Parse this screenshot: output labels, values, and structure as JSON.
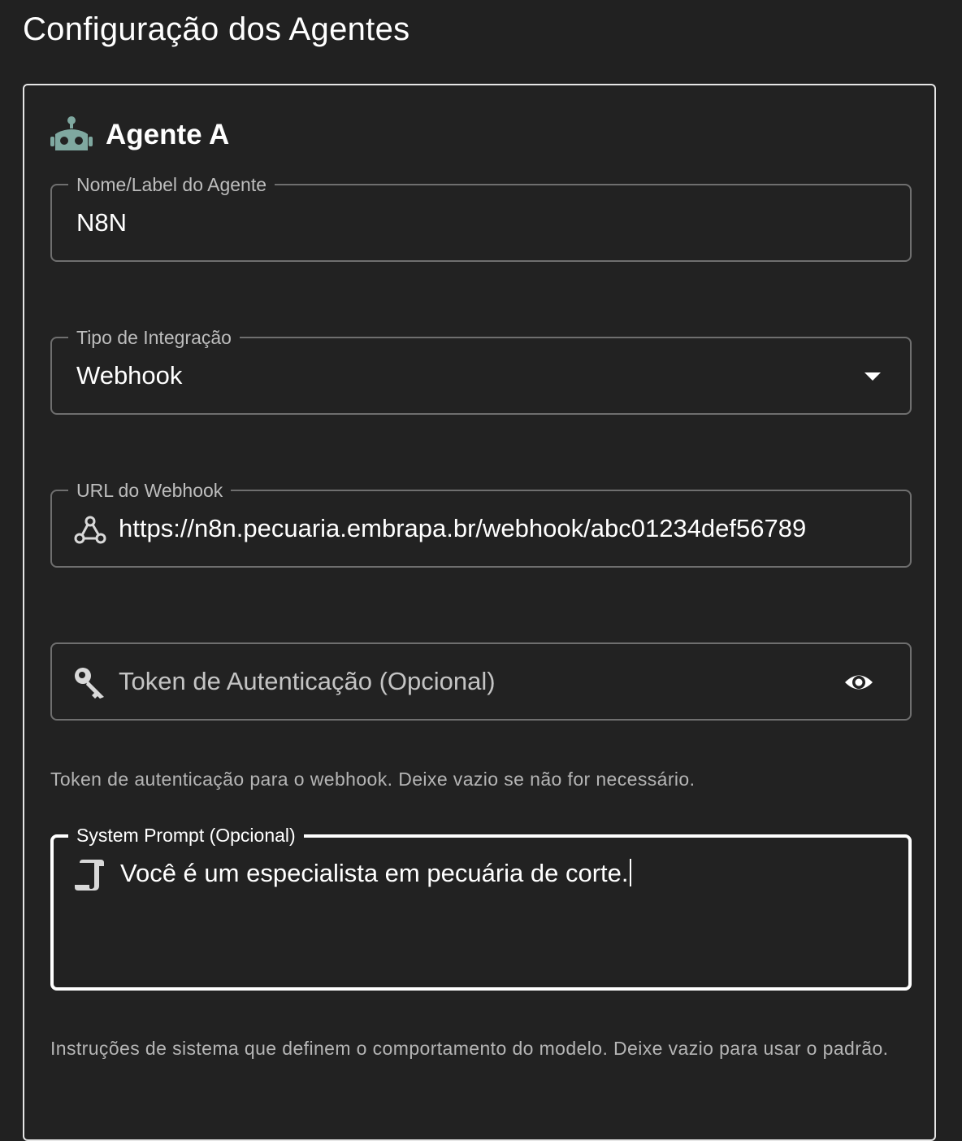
{
  "page": {
    "title": "Configuração dos Agentes"
  },
  "agent": {
    "icon": "robot-icon",
    "title": "Agente A",
    "name_field": {
      "label": "Nome/Label do Agente",
      "value": "N8N"
    },
    "integration_field": {
      "label": "Tipo de Integração",
      "value": "Webhook",
      "icon": "chevron-down-icon"
    },
    "webhook_field": {
      "label": "URL do Webhook",
      "value": "https://n8n.pecuaria.embrapa.br/webhook/abc01234def56789",
      "icon": "webhook-icon"
    },
    "token_field": {
      "placeholder": "Token de Autenticação (Opcional)",
      "value": "",
      "icon": "key-icon",
      "toggle_icon": "eye-icon",
      "helper": "Token de autenticação para o webhook. Deixe vazio se não for necessário."
    },
    "system_prompt_field": {
      "label": "System Prompt (Opcional)",
      "value": "Você é um especialista em pecuária de corte.",
      "icon": "script-icon",
      "helper": "Instruções de sistema que definem o comportamento do modelo. Deixe vazio para usar o padrão."
    }
  },
  "colors": {
    "background": "#212121",
    "card_border": "#e6e6e6",
    "field_border": "#6f6f6f",
    "focused_border": "#ffffff",
    "robot_icon": "#7fa8a0",
    "helper_text": "#b5b5b5"
  }
}
